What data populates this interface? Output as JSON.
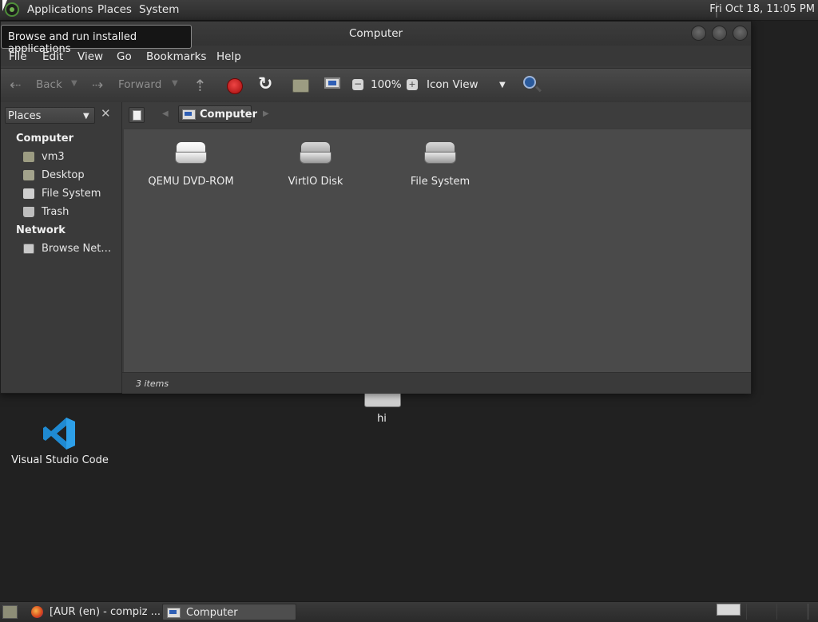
{
  "top_panel": {
    "menu": [
      "Applications",
      "Places",
      "System"
    ],
    "clock": "Fri Oct 18, 11:05 PM"
  },
  "tooltip": "Browse and run installed applications",
  "window": {
    "title": "Computer",
    "menubar": [
      "File",
      "Edit",
      "View",
      "Go",
      "Bookmarks",
      "Help"
    ],
    "toolbar": {
      "back": "Back",
      "forward": "Forward",
      "zoom": "100%",
      "view_mode": "Icon View"
    },
    "sidepane": {
      "selector": "Places",
      "sections": [
        {
          "heading": "Computer",
          "items": [
            {
              "label": "vm3",
              "icon": "home-folder-icon"
            },
            {
              "label": "Desktop",
              "icon": "desktop-icon"
            },
            {
              "label": "File System",
              "icon": "filesystem-icon"
            },
            {
              "label": "Trash",
              "icon": "trash-icon"
            }
          ]
        },
        {
          "heading": "Network",
          "items": [
            {
              "label": "Browse Net…",
              "icon": "network-icon"
            }
          ]
        }
      ]
    },
    "location": {
      "crumb": "Computer"
    },
    "items": [
      {
        "name": "QEMU DVD-ROM",
        "icon": "optical-drive-icon"
      },
      {
        "name": "VirtIO Disk",
        "icon": "hard-disk-icon"
      },
      {
        "name": "File System",
        "icon": "hard-disk-icon"
      }
    ],
    "status": "3 items"
  },
  "desktop": {
    "icons": [
      {
        "label": "Visual Studio Code",
        "icon": "vscode-icon"
      },
      {
        "label": "hi",
        "icon": "file-icon"
      }
    ]
  },
  "taskbar": {
    "tasks": [
      {
        "label": "[AUR (en) - compiz ...",
        "icon": "firefox-icon",
        "active": false
      },
      {
        "label": "Computer",
        "icon": "computer-icon",
        "active": true
      }
    ]
  }
}
